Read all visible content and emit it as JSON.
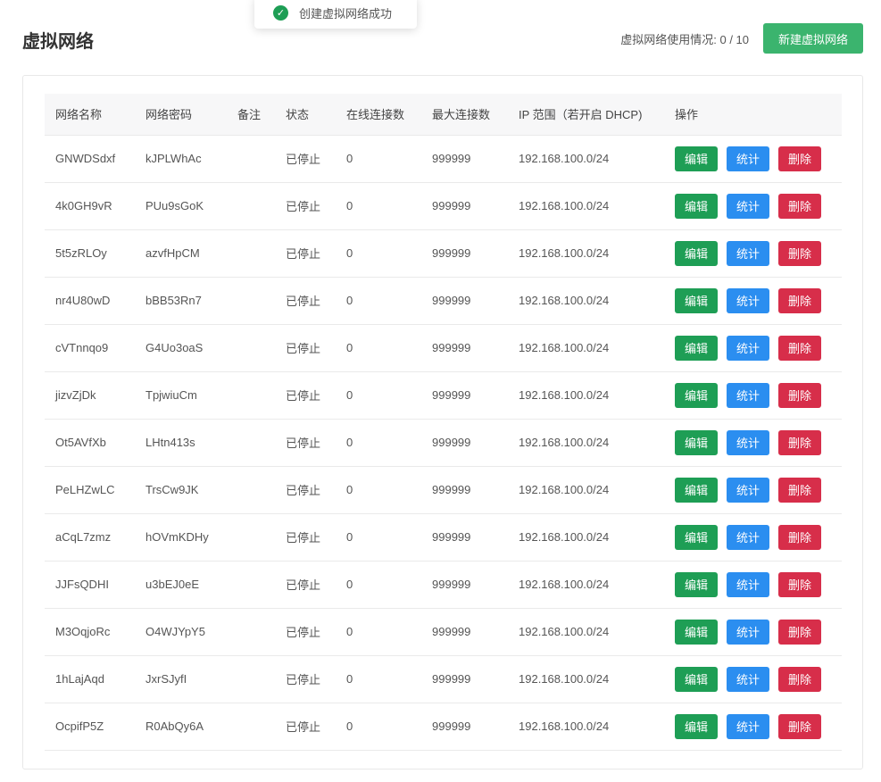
{
  "toast": {
    "message": "创建虚拟网络成功"
  },
  "header": {
    "title": "虚拟网络",
    "usage_text": "虚拟网络使用情况: 0 / 10",
    "new_button": "新建虚拟网络"
  },
  "colors": {
    "edit": "#1e9e55",
    "stats": "#2b8ef0",
    "delete": "#d72e4a",
    "new_button": "#3bb46e"
  },
  "table": {
    "headers": [
      "网络名称",
      "网络密码",
      "备注",
      "状态",
      "在线连接数",
      "最大连接数",
      "IP 范围（若开启 DHCP)",
      "操作"
    ],
    "actions": {
      "edit": "编辑",
      "stats": "统计",
      "delete": "删除"
    },
    "rows": [
      {
        "name": "GNWDSdxf",
        "password": "kJPLWhAc",
        "note": "",
        "status": "已停止",
        "online": "0",
        "max": "999999",
        "ip": "192.168.100.0/24"
      },
      {
        "name": "4k0GH9vR",
        "password": "PUu9sGoK",
        "note": "",
        "status": "已停止",
        "online": "0",
        "max": "999999",
        "ip": "192.168.100.0/24"
      },
      {
        "name": "5t5zRLOy",
        "password": "azvfHpCM",
        "note": "",
        "status": "已停止",
        "online": "0",
        "max": "999999",
        "ip": "192.168.100.0/24"
      },
      {
        "name": "nr4U80wD",
        "password": "bBB53Rn7",
        "note": "",
        "status": "已停止",
        "online": "0",
        "max": "999999",
        "ip": "192.168.100.0/24"
      },
      {
        "name": "cVTnnqo9",
        "password": "G4Uo3oaS",
        "note": "",
        "status": "已停止",
        "online": "0",
        "max": "999999",
        "ip": "192.168.100.0/24"
      },
      {
        "name": "jizvZjDk",
        "password": "TpjwiuCm",
        "note": "",
        "status": "已停止",
        "online": "0",
        "max": "999999",
        "ip": "192.168.100.0/24"
      },
      {
        "name": "Ot5AVfXb",
        "password": "LHtn413s",
        "note": "",
        "status": "已停止",
        "online": "0",
        "max": "999999",
        "ip": "192.168.100.0/24"
      },
      {
        "name": "PeLHZwLC",
        "password": "TrsCw9JK",
        "note": "",
        "status": "已停止",
        "online": "0",
        "max": "999999",
        "ip": "192.168.100.0/24"
      },
      {
        "name": "aCqL7zmz",
        "password": "hOVmKDHy",
        "note": "",
        "status": "已停止",
        "online": "0",
        "max": "999999",
        "ip": "192.168.100.0/24"
      },
      {
        "name": "JJFsQDHI",
        "password": "u3bEJ0eE",
        "note": "",
        "status": "已停止",
        "online": "0",
        "max": "999999",
        "ip": "192.168.100.0/24"
      },
      {
        "name": "M3OqjoRc",
        "password": "O4WJYpY5",
        "note": "",
        "status": "已停止",
        "online": "0",
        "max": "999999",
        "ip": "192.168.100.0/24"
      },
      {
        "name": "1hLajAqd",
        "password": "JxrSJyfI",
        "note": "",
        "status": "已停止",
        "online": "0",
        "max": "999999",
        "ip": "192.168.100.0/24"
      },
      {
        "name": "OcpifP5Z",
        "password": "R0AbQy6A",
        "note": "",
        "status": "已停止",
        "online": "0",
        "max": "999999",
        "ip": "192.168.100.0/24"
      }
    ]
  }
}
